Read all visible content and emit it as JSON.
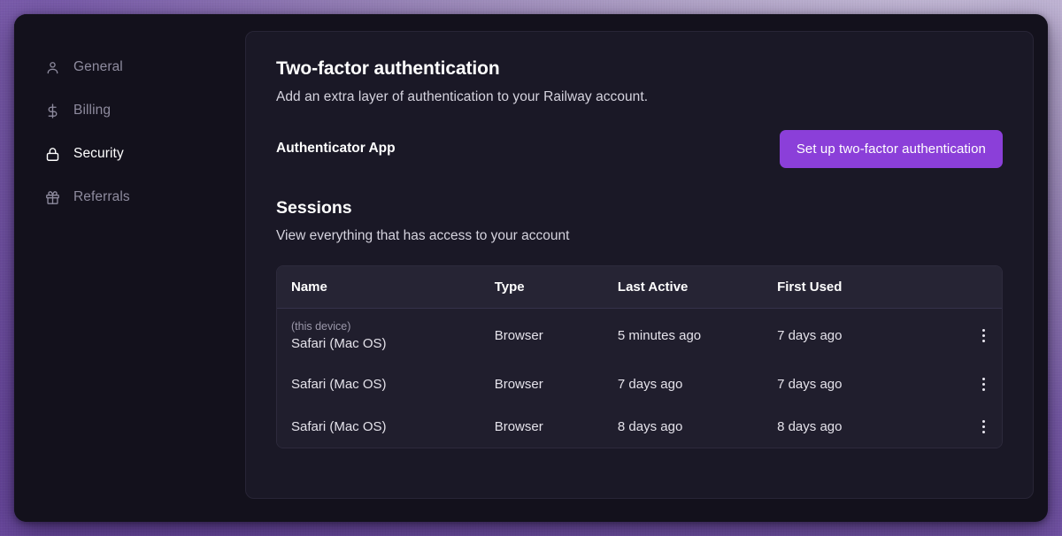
{
  "theme": {
    "accent": "#8b3fd9",
    "window_bg": "#13111c",
    "card_bg": "#1a1826",
    "table_header_bg": "#262434",
    "table_body_bg": "#201e2d",
    "text_primary": "#ffffff",
    "text_muted": "#8e8b9e",
    "frame_purple": "#6b4aa0"
  },
  "sidebar": {
    "items": [
      {
        "label": "General",
        "icon": "user-icon",
        "active": false
      },
      {
        "label": "Billing",
        "icon": "dollar-icon",
        "active": false
      },
      {
        "label": "Security",
        "icon": "lock-icon",
        "active": true
      },
      {
        "label": "Referrals",
        "icon": "gift-icon",
        "active": false
      }
    ]
  },
  "two_factor": {
    "title": "Two-factor authentication",
    "description": "Add an extra layer of authentication to your Railway account.",
    "method_label": "Authenticator App",
    "setup_button": "Set up two-factor authentication"
  },
  "sessions": {
    "title": "Sessions",
    "description": "View everything that has access to your account",
    "columns": [
      "Name",
      "Type",
      "Last Active",
      "First Used"
    ],
    "this_device_tag": "(this device)",
    "rows": [
      {
        "name": "Safari (Mac OS)",
        "type": "Browser",
        "last_active": "5 minutes ago",
        "first_used": "7 days ago",
        "this_device": true
      },
      {
        "name": "Safari (Mac OS)",
        "type": "Browser",
        "last_active": "7 days ago",
        "first_used": "7 days ago",
        "this_device": false
      },
      {
        "name": "Safari (Mac OS)",
        "type": "Browser",
        "last_active": "8 days ago",
        "first_used": "8 days ago",
        "this_device": false
      }
    ],
    "row_menu_icon": "kebab-menu-icon"
  }
}
